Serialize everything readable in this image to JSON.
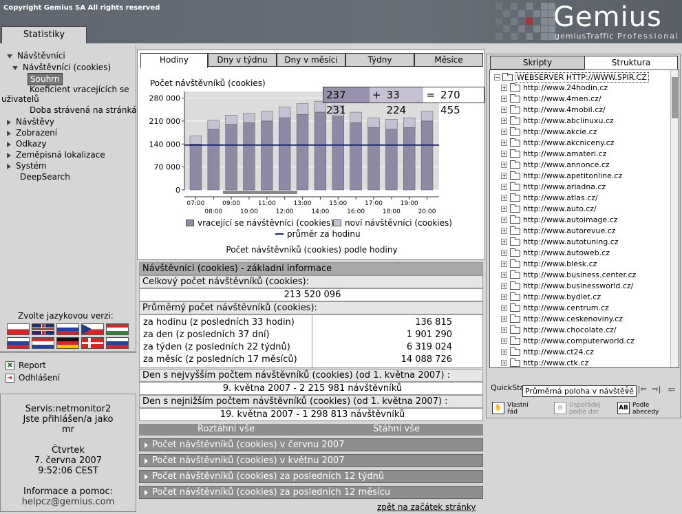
{
  "header": {
    "copyright": "Copyright Gemius SA   All rights reserved",
    "logo": "Gemius",
    "logo_sub": "gemiusTraffic",
    "logo_sub2": "Professional",
    "tab": "Statistiky"
  },
  "nav": {
    "items": [
      {
        "label": "Návštěvníci",
        "state": "open"
      },
      {
        "label": "Návštěvníci (cookies)",
        "state": "open"
      },
      {
        "label": "Souhrn",
        "state": "selected"
      },
      {
        "label": "Koeficient vracejících se",
        "state": "leaf"
      },
      {
        "label": "uživatelů",
        "state": "leaf"
      },
      {
        "label": "Doba strávená na stránkách",
        "state": "leaf"
      },
      {
        "label": "Návštěvy",
        "state": "closed"
      },
      {
        "label": "Zobrazení",
        "state": "closed"
      },
      {
        "label": "Odkazy",
        "state": "closed"
      },
      {
        "label": "Zeměpisná lokalizace",
        "state": "closed"
      },
      {
        "label": "Systém",
        "state": "closed"
      },
      {
        "label": "DeepSearch",
        "state": "leaf"
      }
    ],
    "language_label": "Zvolte jazykovou verzi:",
    "flags_row1": [
      "polish-flag",
      "uk-flag",
      "russian-flag",
      "czech-flag",
      "hungarian-flag"
    ],
    "flags_row2": [
      "slovenian-flag",
      "croatian-flag",
      "german-flag",
      "danish-flag",
      "slovak-flag"
    ],
    "report": "Report",
    "logout": "Odhlášení"
  },
  "info": {
    "service": "Servis:netmonitor2",
    "logged_as": "Jste přihlášen/a jako",
    "user": "mr",
    "day": "Čtvrtek",
    "date": "7. června 2007",
    "time": "9:52:06 CEST",
    "help_label": "Informace a pomoc:",
    "help_email": "helpcz@gemius.com"
  },
  "chart_tabs": [
    "Hodiny",
    "Dny v týdnu",
    "Dny v měsíci",
    "Týdny",
    "Měsíce"
  ],
  "chart_tooltip": {
    "v1": "237 231",
    "op1": "+",
    "v2": "33 224",
    "op2": "=",
    "v3": "270 455"
  },
  "chart_data": {
    "type": "bar",
    "title": "Počet návštěvníků (cookies)",
    "caption": "Počet návštěvníků (cookies) podle hodiny",
    "categories": [
      "07:00",
      "08:00",
      "09:00",
      "10:00",
      "11:00",
      "12:00",
      "13:00",
      "14:00",
      "15:00",
      "16:00",
      "17:00",
      "18:00",
      "19:00",
      "20:00"
    ],
    "series": [
      {
        "name": "vracející se návštěvníci (cookies)",
        "color": "#8e8aa6",
        "values": [
          140000,
          185000,
          200000,
          205000,
          210000,
          220000,
          230000,
          237231,
          225000,
          205000,
          190000,
          185000,
          190000,
          210000
        ]
      },
      {
        "name": "noví návštěvníci (cookies)",
        "color": "#c6c2d3",
        "values": [
          25000,
          28000,
          28000,
          28000,
          30000,
          33000,
          33000,
          33224,
          33000,
          32000,
          30000,
          30000,
          30000,
          30000
        ]
      }
    ],
    "average": {
      "name": "průměr za hodinu",
      "value": 136815,
      "color": "#1a2a6c"
    },
    "ylim": [
      0,
      300000
    ],
    "yticks": [
      "0",
      "70 000",
      "140 000",
      "210 000",
      "280 000"
    ],
    "ytick_values": [
      0,
      70000,
      140000,
      210000,
      280000
    ]
  },
  "table": {
    "header": "Návštěvníci (cookies) - základní informace",
    "total_label": "Celkový počet návštěvníků (cookies):",
    "total_value": "213 520 096",
    "avg_label": "Průměrný počet návštěvníků (cookies):",
    "avg_rows": [
      {
        "label": "za hodinu (z posledních 33 hodin)",
        "value": "136 815"
      },
      {
        "label": "za den (z posledních 37 dní)",
        "value": "1 901 290"
      },
      {
        "label": "za týden (z posledních 22 týdnů)",
        "value": "6 319 024"
      },
      {
        "label": "za měsíc (z posledních 17 měsíců)",
        "value": "14 088 726"
      }
    ],
    "max_label": "Den s nejvyšším počtem návštěvníků (cookies) (od 1. května 2007) :",
    "max_value": "9. května 2007 - 2 215 981 návštěvníků",
    "min_label": "Den s nejnižším počtem návštěvníků (cookies) (od 1. května 2007) :",
    "min_value": "19. května 2007 - 1 298 813 návštěvníků"
  },
  "expand": {
    "expand_all": "Roztáhni vše",
    "collapse_all": "Stáhni vše",
    "sections": [
      "Počet návštěvníků (cookies) v červnu 2007",
      "Počet návštěvníků (cookies) v květnu 2007",
      "Počet návštěvníků (cookies) za posledních 12 týdnů",
      "Počet návštěvníků (cookies) za posledních 12 měsícu"
    ],
    "back_top": "zpět na začátek stránky"
  },
  "right": {
    "tabs": [
      "Skripty",
      "Struktura"
    ],
    "root": "WEBSERVER HTTP://WWW.SPIR.CZ",
    "items": [
      "http://www.24hodin.cz",
      "http://www.4men.cz/",
      "http://www.4mobil.cz/",
      "http://www.abclinuxu.cz",
      "http://www.akcie.cz",
      "http://www.akcniceny.cz",
      "http://www.amateri.cz",
      "http://www.annonce.cz",
      "http://www.apetitonline.cz",
      "http://www.ariadna.cz",
      "http://www.atlas.cz/",
      "http://www.auto.cz/",
      "http://www.autoimage.cz",
      "http://www.autorevue.cz",
      "http://www.autotuning.cz",
      "http://www.autoweb.cz",
      "http://www.blesk.cz",
      "http://www.business.center.cz",
      "http://www.businessworld.cz/",
      "http://www.bydlet.cz",
      "http://www.centrum.cz",
      "http://www.ceskenoviny.cz",
      "http://www.chocolate.cz/",
      "http://www.computerworld.cz",
      "http://www.ct24.cz",
      "http://www.ctk.cz"
    ],
    "quickstats": "QuickSta",
    "qs_tooltip": "Průměrná poloha v návštěvě",
    "sort_options": [
      {
        "icon": "hand-icon",
        "line1": "Vlastní",
        "line2": "řád"
      },
      {
        "icon": "sort-data-icon",
        "line1": "Uspořádej",
        "line2": "podle dat"
      },
      {
        "icon": "ab-icon",
        "line1": "Podle",
        "line2": "abecedy"
      }
    ]
  }
}
